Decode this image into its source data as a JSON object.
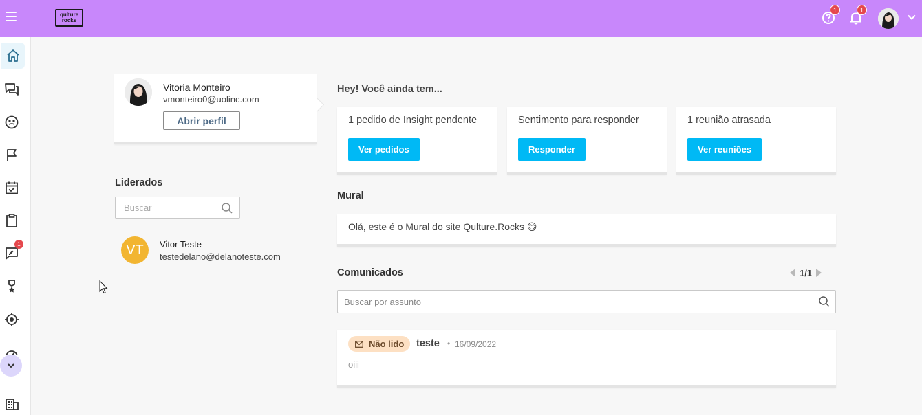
{
  "header": {
    "logo_line1": "qulture",
    "logo_line2": "rocks",
    "help_badge": "1",
    "notifications_badge": "1",
    "colors": {
      "bar": "#c887fb",
      "badge": "#e5484d"
    }
  },
  "sidebar": {
    "items": [
      {
        "icon": "home-icon",
        "active": true
      },
      {
        "icon": "chat-icon"
      },
      {
        "icon": "feedback-icon"
      },
      {
        "icon": "flag-icon"
      },
      {
        "icon": "calendar-check-icon"
      },
      {
        "icon": "clipboard-icon"
      },
      {
        "icon": "review-icon",
        "badge": "1"
      },
      {
        "icon": "award-icon"
      },
      {
        "icon": "target-icon"
      },
      {
        "icon": "gauge-icon"
      },
      {
        "icon": "building-icon"
      }
    ]
  },
  "profile": {
    "name": "Vitoria Monteiro",
    "email": "vmonteiro0@uolinc.com",
    "open_profile_label": "Abrir perfil"
  },
  "liderados": {
    "title": "Liderados",
    "search_placeholder": "Buscar",
    "members": [
      {
        "initials": "VT",
        "name": "Vitor Teste",
        "email": "testedelano@delanoteste.com"
      }
    ]
  },
  "pending": {
    "title": "Hey! Você ainda tem...",
    "cards": [
      {
        "text": "1 pedido de Insight pendente",
        "button": "Ver pedidos"
      },
      {
        "text": "Sentimento para responder",
        "button": "Responder"
      },
      {
        "text": "1 reunião atrasada",
        "button": "Ver reuniões"
      }
    ],
    "button_color": "#00b9f5"
  },
  "mural": {
    "title": "Mural",
    "text": "Olá, este é o Mural do site Qulture.Rocks 😄"
  },
  "comunicados": {
    "title": "Comunicados",
    "page": "1/1",
    "search_placeholder": "Buscar por assunto",
    "items": [
      {
        "status": "Não lido",
        "title": "teste",
        "separator": "•",
        "date": "16/09/2022",
        "body": "oiii"
      }
    ]
  }
}
